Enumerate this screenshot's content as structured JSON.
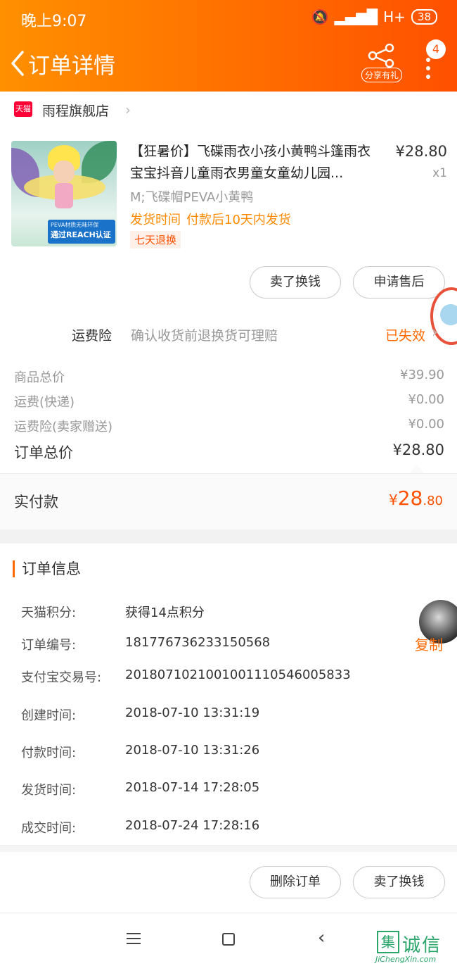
{
  "status_bar": {
    "time": "晚上9:07",
    "signal": "H+",
    "battery": "38"
  },
  "header": {
    "title": "订单详情",
    "share_label": "分享有礼",
    "badge_count": "4"
  },
  "shop": {
    "platform": "天猫",
    "name": "雨程旗舰店"
  },
  "product": {
    "title": "【狂暑价】飞碟雨衣小孩小黄鸭斗篷雨衣宝宝抖音儿童雨衣男童女童幼儿园...",
    "price": "¥28.80",
    "qty": "x1",
    "sku": "M;飞碟帽PEVA小黄鸭",
    "ship_label": "发货时间",
    "ship_value": "付款后10天内发货",
    "return_tag": "七天退换",
    "image_text_small": "PEVA材质无味环保",
    "image_text_big": "通过REACH认证"
  },
  "actions_top": {
    "sell": "卖了换钱",
    "after_sale": "申请售后"
  },
  "insurance": {
    "label": "运费险",
    "desc": "确认收货前退换货可理赔",
    "status": "已失效"
  },
  "summary": {
    "goods_label": "商品总价",
    "goods_value": "¥39.90",
    "freight_label": "运费(快递)",
    "freight_value": "¥0.00",
    "ins_label": "运费险(卖家赠送)",
    "ins_value": "¥0.00",
    "total_label": "订单总价",
    "total_value": "¥28.80",
    "paid_label": "实付款",
    "paid_yen": "¥",
    "paid_int": "28",
    "paid_dec": ".80"
  },
  "order_info": {
    "heading": "订单信息",
    "copy": "复制",
    "rows": [
      {
        "k": "天猫积分:",
        "v": "获得14点积分"
      },
      {
        "k": "订单编号:",
        "v": "181776736233150568"
      },
      {
        "k": "支付宝交易号:",
        "v": "2018071021001001110546005833"
      },
      {
        "k": "创建时间:",
        "v": "2018-07-10 13:31:19"
      },
      {
        "k": "付款时间:",
        "v": "2018-07-10 13:31:26"
      },
      {
        "k": "发货时间:",
        "v": "2018-07-14 17:28:05"
      },
      {
        "k": "成交时间:",
        "v": "2018-07-24 17:28:16"
      }
    ]
  },
  "actions_bottom": {
    "delete": "删除订单",
    "sell": "卖了换钱"
  },
  "watermark": {
    "cn": "诚信",
    "box": "集",
    "en": "JiChengXin.com"
  },
  "colors": {
    "accent": "#ff6a00",
    "price_red": "#ff5000",
    "tmall": "#ff0036"
  }
}
